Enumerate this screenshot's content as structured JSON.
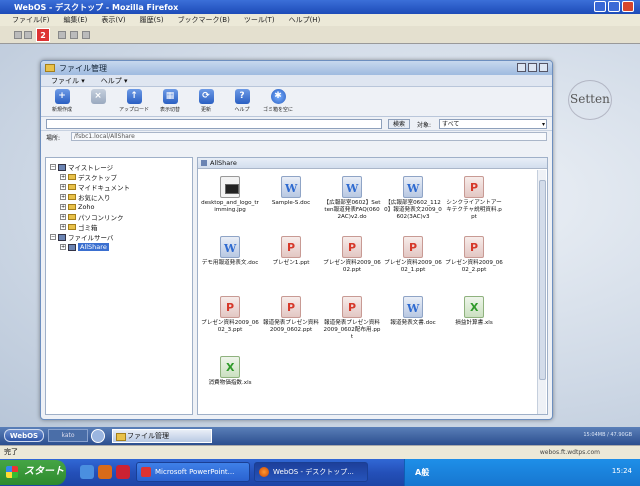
{
  "browser": {
    "title": "WebOS - デスクトップ - Mozilla Firefox",
    "menu": [
      "ファイル(F)",
      "編集(E)",
      "表示(V)",
      "履歴(S)",
      "ブックマーク(B)",
      "ツール(T)",
      "ヘルプ(H)"
    ],
    "tab_badge": "2",
    "status_left": "完了",
    "status_url": "webos.ft.wdtps.com"
  },
  "desktop": {
    "logo": "Setten"
  },
  "file_manager": {
    "title": "ファイル管理",
    "menu": [
      "ファイル ▾",
      "ヘルプ ▾"
    ],
    "toolbar": [
      {
        "label": "新規作成",
        "icon": "+",
        "icon_name": "new-icon",
        "enabled": true
      },
      {
        "label": "",
        "icon": "×",
        "icon_name": "delete-icon",
        "enabled": false
      },
      {
        "label": "アップロード",
        "icon": "↑",
        "icon_name": "upload-icon",
        "enabled": true
      },
      {
        "label": "表示切替",
        "icon": "▦",
        "icon_name": "view-toggle-icon",
        "enabled": true
      },
      {
        "label": "更新",
        "icon": "⟳",
        "icon_name": "refresh-icon",
        "enabled": true
      },
      {
        "label": "ヘルプ",
        "icon": "?",
        "icon_name": "help-icon",
        "enabled": true
      },
      {
        "label": "ゴミ箱を空に",
        "icon": "✱",
        "icon_name": "empty-trash-icon",
        "enabled": true
      }
    ],
    "search": {
      "button": "検索",
      "target_label": "対象:",
      "target_value": "すべて"
    },
    "location": {
      "label": "場所:",
      "path": "/fsbc1.local/AllShare"
    },
    "tree": [
      {
        "label": "マイストレージ",
        "level": 0,
        "type": "root"
      },
      {
        "label": "デスクトップ",
        "level": 1,
        "type": "folder"
      },
      {
        "label": "マイドキュメント",
        "level": 1,
        "type": "folder"
      },
      {
        "label": "お気に入り",
        "level": 1,
        "type": "folder"
      },
      {
        "label": "Zoho",
        "level": 1,
        "type": "folder"
      },
      {
        "label": "パソコンリンク",
        "level": 1,
        "type": "folder"
      },
      {
        "label": "ゴミ箱",
        "level": 1,
        "type": "folder"
      },
      {
        "label": "ファイルサーバ",
        "level": 0,
        "type": "root"
      },
      {
        "label": "AllShare",
        "level": 1,
        "type": "share",
        "selected": true
      }
    ],
    "main_header": "AllShare",
    "files": [
      {
        "name": "desktop_and_logo_trimming.jpg",
        "kind": "img"
      },
      {
        "name": "Sample-S.doc",
        "kind": "w"
      },
      {
        "name": "【広報部室0602】Setten報道発表FAQ(0602AC)v2.do",
        "kind": "w"
      },
      {
        "name": "【広報部室0602_1120】報道発表文2009_0602(3AC)v3",
        "kind": "w"
      },
      {
        "name": "シンクライアントアーキテクチャ説明資料.ppt",
        "kind": "p"
      },
      {
        "name": "デモ用報道発表文.doc",
        "kind": "w"
      },
      {
        "name": "プレゼン1.ppt",
        "kind": "p"
      },
      {
        "name": "プレゼン資料2009_0602.ppt",
        "kind": "p"
      },
      {
        "name": "プレゼン資料2009_0602_1.ppt",
        "kind": "p"
      },
      {
        "name": "プレゼン資料2009_0602_2.ppt",
        "kind": "p"
      },
      {
        "name": "プレゼン資料2009_0602_3.ppt",
        "kind": "p"
      },
      {
        "name": "報道発表プレゼン資料2009_0602.ppt",
        "kind": "p"
      },
      {
        "name": "報道発表プレゼン資料2009_0602配布用.ppt",
        "kind": "p"
      },
      {
        "name": "報道発表文書.doc",
        "kind": "w"
      },
      {
        "name": "損益計算書.xls",
        "kind": "x"
      },
      {
        "name": "消費物価指数.xls",
        "kind": "x"
      }
    ]
  },
  "webos_taskbar": {
    "start": "WebOS",
    "user": "kato",
    "task": "ファイル管理",
    "clock": "15:04MB / 47.90GB"
  },
  "windows_taskbar": {
    "start": "スタート",
    "tasks": [
      {
        "label": "Microsoft PowerPoint...",
        "active": false
      },
      {
        "label": "WebOS - デスクトップ...",
        "active": true
      }
    ],
    "tray": "A般",
    "clock": "15:24"
  }
}
